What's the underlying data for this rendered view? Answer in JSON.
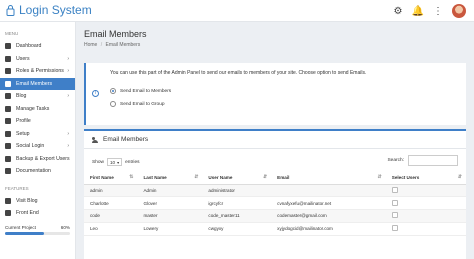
{
  "app": {
    "title": "Login System"
  },
  "topbar": {
    "icons": [
      "gear-icon",
      "bell-icon",
      "more-vertical-icon",
      "avatar"
    ]
  },
  "sidebar": {
    "menu_heading": "MENU",
    "items": [
      {
        "label": "Dashboard",
        "icon": "home-icon",
        "has_children": false
      },
      {
        "label": "Users",
        "icon": "users-icon",
        "has_children": true
      },
      {
        "label": "Roles & Permissions",
        "icon": "key-icon",
        "has_children": true
      },
      {
        "label": "Email Members",
        "icon": "mail-icon",
        "has_children": false,
        "active": true
      },
      {
        "label": "Blog",
        "icon": "pen-icon",
        "has_children": true
      },
      {
        "label": "Manage Tasks",
        "icon": "tasks-icon",
        "has_children": false
      },
      {
        "label": "Profile",
        "icon": "user-icon",
        "has_children": false
      },
      {
        "label": "Setup",
        "icon": "gear-icon",
        "has_children": true
      },
      {
        "label": "Social Login",
        "icon": "globe-icon",
        "has_children": true
      },
      {
        "label": "Backup & Export Users",
        "icon": "download-icon",
        "has_children": false
      },
      {
        "label": "Documentation",
        "icon": "book-icon",
        "has_children": false
      }
    ],
    "features_heading": "FEATURES",
    "features": [
      {
        "label": "Visit Blog",
        "icon": "blog-icon"
      },
      {
        "label": "Front End",
        "icon": "monitor-icon"
      }
    ],
    "progress": {
      "label": "Current Project",
      "value_text": "60%",
      "value": 0.6
    }
  },
  "main": {
    "title": "Email Members",
    "breadcrumb": [
      "Home",
      "Email Members"
    ],
    "notice": "You can use this part of the Admin Panel to send our emails to members of your site. Choose option to send Emails.",
    "options": [
      {
        "label": "Send Email to Members",
        "checked": true
      },
      {
        "label": "Send Email to Group",
        "checked": false
      }
    ]
  },
  "members": {
    "title": "Email Members",
    "show_label": "Show",
    "entries_value": "10",
    "entries_label": "entries",
    "search_label": "Search:",
    "search_value": "",
    "columns": [
      "First Name",
      "Last Name",
      "User Name",
      "Email",
      "Select Users"
    ],
    "rows": [
      [
        "admin",
        "Admin",
        "administrator",
        "",
        ""
      ],
      [
        "Charlotte",
        "Glover",
        "igrcyfcr",
        "cvnafyxefu@mailinator.net",
        ""
      ],
      [
        "code",
        "master",
        "code_master11",
        "codemaster@gmail.com",
        ""
      ],
      [
        "Leo",
        "Lowery",
        "cwgyxy",
        "xyjydogcid@mailinator.com",
        ""
      ]
    ]
  },
  "colors": {
    "accent": "#3f7fc8",
    "background": "#eceff3"
  }
}
